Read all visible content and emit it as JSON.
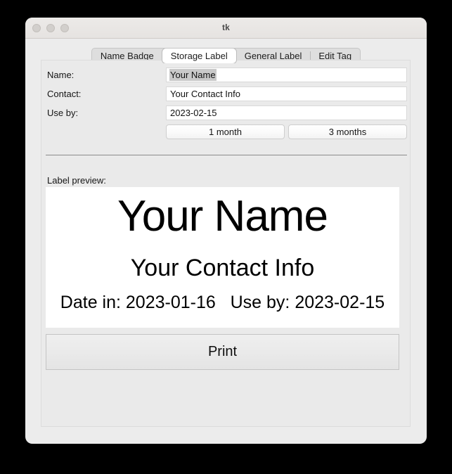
{
  "window": {
    "title": "tk",
    "traffic_lights": [
      "close-button",
      "minimize-button",
      "zoom-button"
    ]
  },
  "tabs": [
    {
      "label": "Name Badge",
      "selected": false
    },
    {
      "label": "Storage Label",
      "selected": true
    },
    {
      "label": "General Label",
      "selected": false
    },
    {
      "label": "Edit Tag",
      "selected": false
    }
  ],
  "form": {
    "fields": [
      {
        "label": "Name:",
        "value": "Your Name",
        "selected": true
      },
      {
        "label": "Contact:",
        "value": "Your Contact Info",
        "selected": false
      },
      {
        "label": "Use by:",
        "value": "2023-02-15",
        "selected": false
      }
    ],
    "quick_buttons": [
      {
        "label": "1 month"
      },
      {
        "label": "3 months"
      }
    ]
  },
  "preview": {
    "heading": "Label preview:",
    "name": "Your Name",
    "contact": "Your Contact Info",
    "dates": "Date in: 2023-01-16   Use by: 2023-02-15"
  },
  "actions": {
    "print_label": "Print"
  },
  "colors": {
    "window_background": "#ececec",
    "panel_background": "#eaeaea",
    "entry_background": "#ffffff",
    "selection_highlight": "#c9c9c9",
    "canvas_background": "#ffffff",
    "text": "#141414",
    "separator": "#8a8a8a"
  }
}
